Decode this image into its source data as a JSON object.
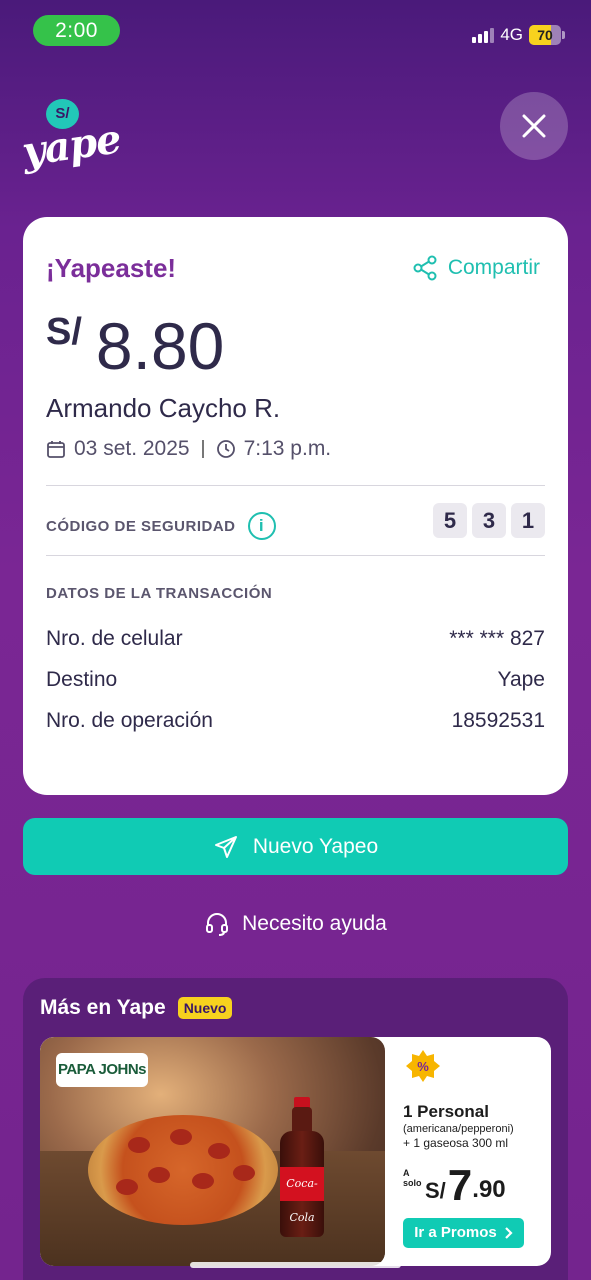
{
  "status_bar": {
    "time": "2:00",
    "network": "4G",
    "battery": "70",
    "battery_level": 0.7
  },
  "logo": {
    "badge": "S/",
    "text": "yape"
  },
  "receipt": {
    "heading": "¡Yapeaste!",
    "share_label": "Compartir",
    "currency": "S/",
    "amount": "8.80",
    "recipient": "Armando Caycho R.",
    "date": "03 set. 2025",
    "time": "7:13 p.m.",
    "security_label": "CÓDIGO DE SEGURIDAD",
    "security_code": [
      "5",
      "3",
      "1"
    ],
    "transaction_title": "DATOS DE LA TRANSACCIÓN",
    "rows": [
      {
        "label": "Nro. de celular",
        "value": "*** *** 827"
      },
      {
        "label": "Destino",
        "value": "Yape"
      },
      {
        "label": "Nro. de operación",
        "value": "18592531"
      }
    ]
  },
  "actions": {
    "primary": "Nuevo Yapeo",
    "help": "Necesito ayuda"
  },
  "promo": {
    "section_title": "Más en Yape",
    "badge": "Nuevo",
    "brand": "PAPA JOHNs",
    "bottle_label": "Coca-Cola",
    "line1": "1 Personal",
    "line2": "(americana/pepperoni)",
    "line3": "+ 1 gaseosa 300 ml",
    "price_prefix": "A solo",
    "price_currency": "S/",
    "price_int": "7",
    "price_dec": ".90",
    "button": "Ir a Promos"
  },
  "colors": {
    "primary": "#10cbb4",
    "brand_purple": "#7a2694",
    "accent_yellow": "#f7d21e"
  }
}
